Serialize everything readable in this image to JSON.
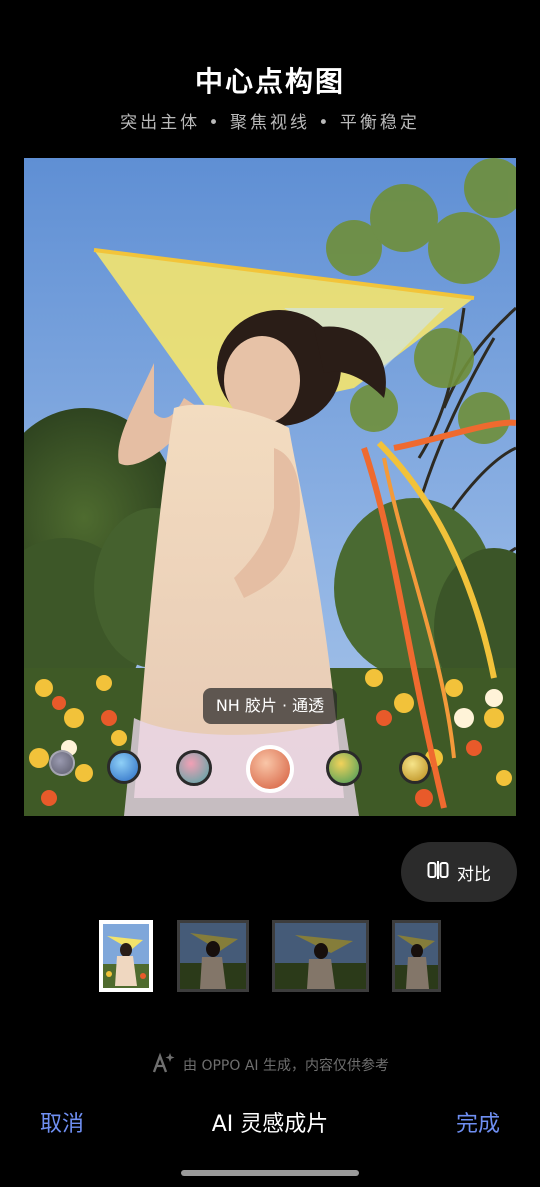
{
  "header": {
    "title": "中心点构图",
    "subtitle": "突出主体 • 聚焦视线 • 平衡稳定"
  },
  "preview": {
    "filter_label": "NH 胶片 · 通透"
  },
  "compare": {
    "label": "对比",
    "icon": "compare-split-icon"
  },
  "disclaimer": {
    "text": "由 OPPO AI 生成，内容仅供参考",
    "icon": "ai-sparkle-icon"
  },
  "bottom_bar": {
    "cancel_label": "取消",
    "title": "AI 灵感成片",
    "done_label": "完成"
  },
  "colors": {
    "accent": "#6f8ff2",
    "background": "#000000",
    "pill": "#2b2b2b"
  }
}
